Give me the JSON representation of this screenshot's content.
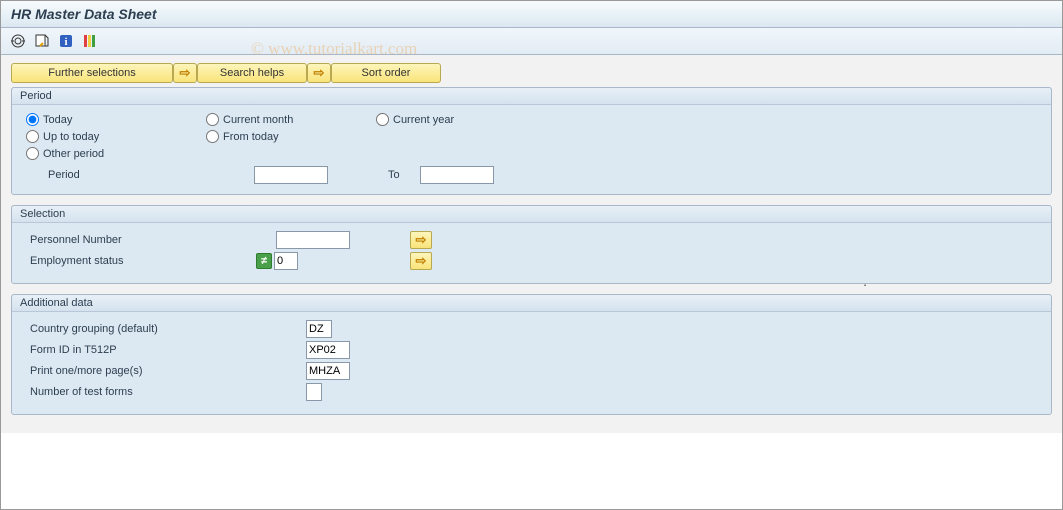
{
  "title": "HR Master Data Sheet",
  "watermark": "© www.tutorialkart.com",
  "buttons": {
    "further_selections": "Further selections",
    "search_helps": "Search helps",
    "sort_order": "Sort order"
  },
  "period_group": {
    "title": "Period",
    "today": "Today",
    "current_month": "Current month",
    "current_year": "Current year",
    "up_to_today": "Up to today",
    "from_today": "From today",
    "other_period": "Other period",
    "period_label": "Period",
    "to_label": "To",
    "period_from": "",
    "period_to": ""
  },
  "selection_group": {
    "title": "Selection",
    "personnel_number": "Personnel Number",
    "personnel_number_val": "",
    "employment_status": "Employment status",
    "employment_status_val": "0"
  },
  "additional_group": {
    "title": "Additional data",
    "country_grouping": "Country grouping (default)",
    "country_grouping_val": "DZ",
    "form_id": "Form ID in T512P",
    "form_id_val": "XP02",
    "print_pages": "Print one/more page(s)",
    "print_pages_val": "MHZA",
    "test_forms": "Number of test forms",
    "test_forms_val": ""
  }
}
